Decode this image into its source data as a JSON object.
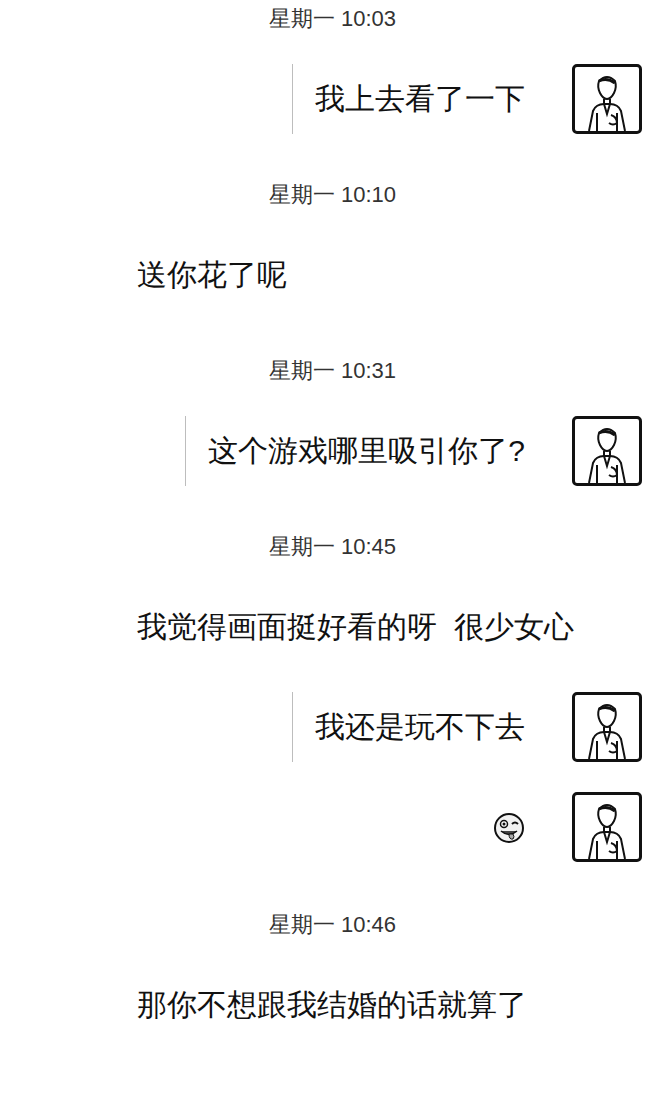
{
  "messages": [
    {
      "kind": "time",
      "text": "星期一 10:03"
    },
    {
      "kind": "text",
      "outgoing": true,
      "text": "我上去看了一下"
    },
    {
      "kind": "time",
      "text": "星期一 10:10"
    },
    {
      "kind": "text",
      "outgoing": false,
      "text": "送你花了呢"
    },
    {
      "kind": "time",
      "text": "星期一 10:31"
    },
    {
      "kind": "text",
      "outgoing": true,
      "text": "这个游戏哪里吸引你了?"
    },
    {
      "kind": "time",
      "text": "星期一 10:45"
    },
    {
      "kind": "text",
      "outgoing": false,
      "text": "我觉得画面挺好看的呀  很少女心"
    },
    {
      "kind": "text",
      "outgoing": true,
      "text": "我还是玩不下去"
    },
    {
      "kind": "emoji",
      "outgoing": true
    },
    {
      "kind": "time",
      "text": "星期一 10:46"
    },
    {
      "kind": "text",
      "outgoing": false,
      "text": "那你不想跟我结婚的话就算了"
    }
  ]
}
